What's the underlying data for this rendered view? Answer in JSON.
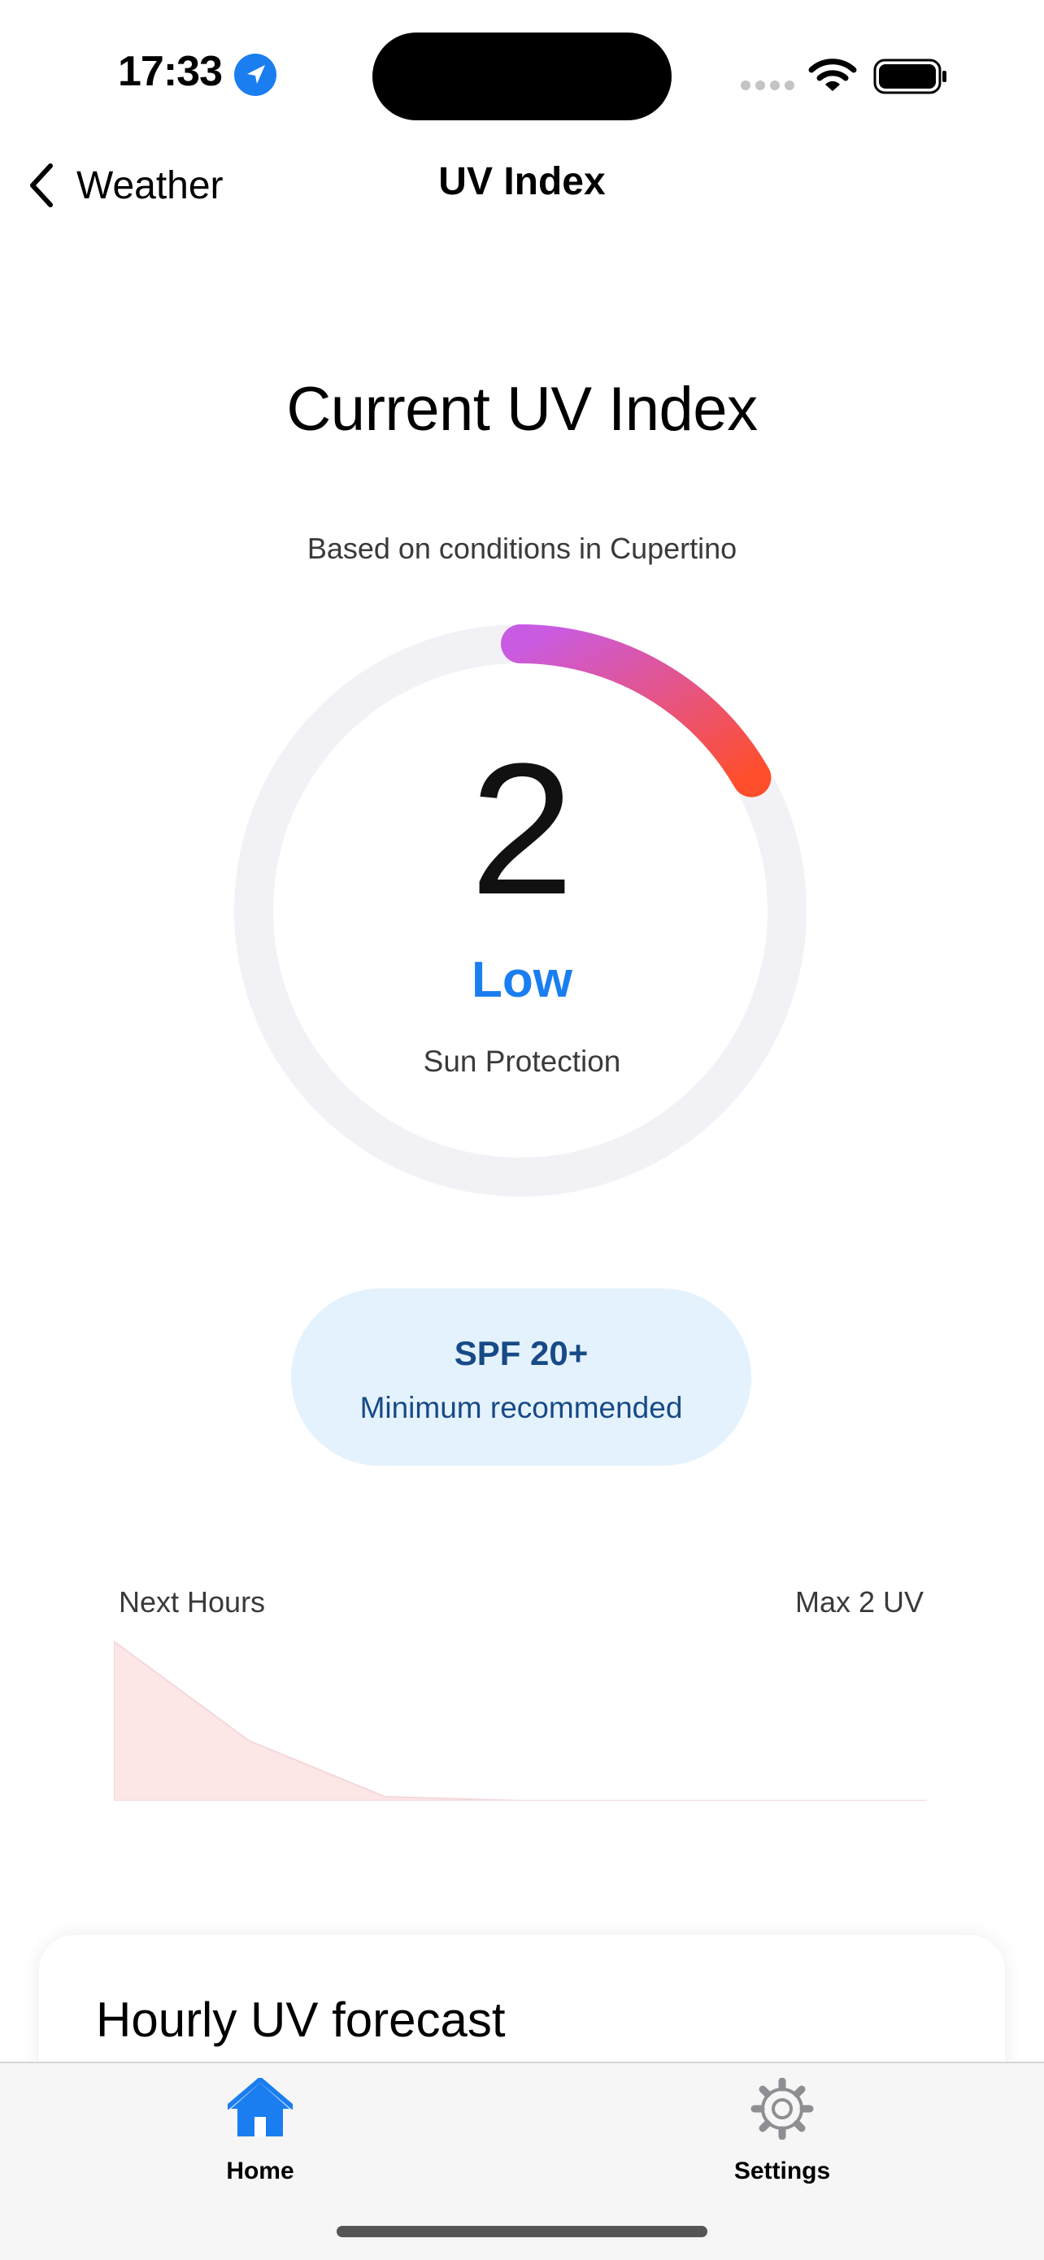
{
  "status_bar": {
    "time": "17:33",
    "icons": [
      "location-arrow-icon",
      "signal-icon",
      "wifi-icon",
      "battery-icon"
    ]
  },
  "nav": {
    "back_label": "Weather",
    "title": "UV Index"
  },
  "header": {
    "title": "Current UV Index",
    "subtitle": "Based on conditions in Cupertino"
  },
  "gauge": {
    "value": "2",
    "level": "Low",
    "caption": "Sun Protection",
    "fraction_filled": 0.167,
    "gradient_start": "#c95be3",
    "gradient_end": "#ff4e2b",
    "track_color": "#f2f2f6",
    "level_color": "#1a7ef0"
  },
  "spf": {
    "title": "SPF 20+",
    "subtitle": "Minimum recommended",
    "bg_color": "#e4f2fd",
    "text_color": "#174a86"
  },
  "chart_data": {
    "type": "area",
    "title": "",
    "left_label": "Next Hours",
    "right_label": "Max 2 UV",
    "x": [
      0,
      1,
      2,
      3,
      4,
      5,
      6
    ],
    "values": [
      2,
      0.75,
      0.05,
      0,
      0,
      0,
      0
    ],
    "ylim": [
      0,
      2
    ],
    "fill_color": "#fde6e6",
    "grid": false
  },
  "hourly": {
    "title": "Hourly UV forecast"
  },
  "tabbar": {
    "tabs": [
      {
        "label": "Home",
        "icon": "house-icon",
        "active": true,
        "color": "#1a7ef0"
      },
      {
        "label": "Settings",
        "icon": "gear-icon",
        "active": false,
        "color": "#8e8e93"
      }
    ]
  }
}
